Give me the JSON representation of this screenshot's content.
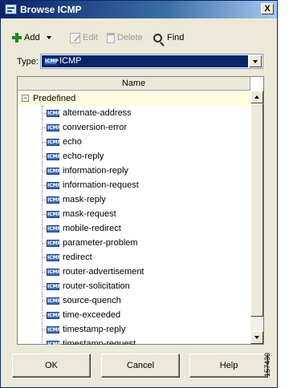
{
  "window": {
    "title": "Browse ICMP",
    "close_label": "X"
  },
  "toolbar": {
    "add_label": "Add",
    "edit_label": "Edit",
    "delete_label": "Delete",
    "find_label": "Find"
  },
  "type_field": {
    "label": "Type:",
    "value": "ICMP",
    "badge": "ICMP"
  },
  "list": {
    "column_header": "Name",
    "group": {
      "label": "Predefined",
      "expander": "−"
    },
    "badge": "ICMP",
    "items": [
      "alternate-address",
      "conversion-error",
      "echo",
      "echo-reply",
      "information-reply",
      "information-request",
      "mask-reply",
      "mask-request",
      "mobile-redirect",
      "parameter-problem",
      "redirect",
      "router-advertisement",
      "router-solicitation",
      "source-quench",
      "time-exceeded",
      "timestamp-reply",
      "timestamp-request"
    ]
  },
  "buttons": {
    "ok": "OK",
    "cancel": "Cancel",
    "help": "Help"
  },
  "figure_number": "157430",
  "colors": {
    "selection": "#0a246a",
    "window_bg": "#ece9d8",
    "group_row_bg": "#fffde0",
    "icmp_badge": "#3d6ebe"
  }
}
